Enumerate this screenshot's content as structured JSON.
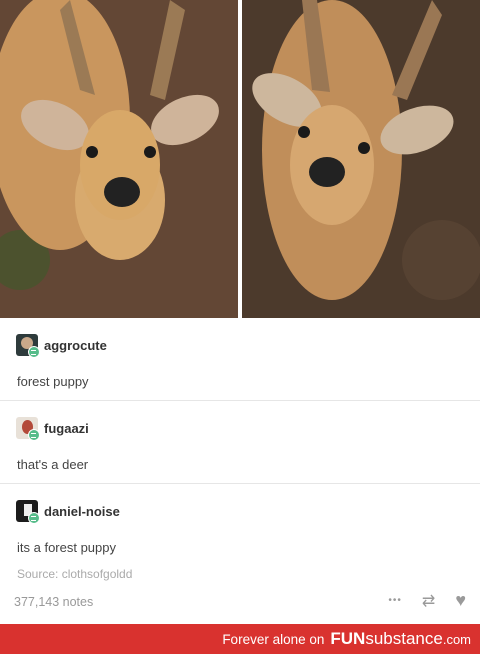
{
  "photos": [
    {
      "icon": "deer-photo"
    },
    {
      "icon": "deer-photo"
    }
  ],
  "reblogs": [
    {
      "user": "aggrocute",
      "text": "forest puppy"
    },
    {
      "user": "fugaazi",
      "text": "that's a deer"
    },
    {
      "user": "daniel-noise",
      "text": "its a forest puppy"
    }
  ],
  "source": "Source: clothsofgoldd",
  "notes": "377,143 notes",
  "actions": {
    "more": "•••",
    "reblog": "⇄",
    "like": "♥"
  },
  "footer": {
    "tagline": "Forever alone on",
    "brand_fun": "FUN",
    "brand_sub": "substance",
    "brand_dom": ".com"
  },
  "colors": {
    "footer_bg": "#d9322f",
    "badge": "#56bc8a"
  }
}
